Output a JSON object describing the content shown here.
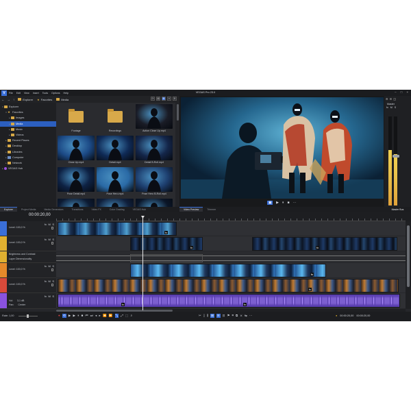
{
  "app": {
    "title": "VEGAS Pro 23.0",
    "logo": "V"
  },
  "menu": [
    "File",
    "Edit",
    "View",
    "Insert",
    "Tools",
    "Options",
    "Help"
  ],
  "explorer_toolbar": {
    "crumbs": [
      "Explorer",
      "Favorites",
      "Media"
    ]
  },
  "tree": [
    {
      "label": "Explorer",
      "indent": 0,
      "icon": "folder",
      "open": true
    },
    {
      "label": "Favorites",
      "indent": 1,
      "icon": "star",
      "open": true
    },
    {
      "label": "Images",
      "indent": 2,
      "icon": "folder"
    },
    {
      "label": "Media",
      "indent": 2,
      "icon": "folder",
      "selected": true
    },
    {
      "label": "Music",
      "indent": 2,
      "icon": "folder"
    },
    {
      "label": "Videos",
      "indent": 2,
      "icon": "folder"
    },
    {
      "label": "Recent Places",
      "indent": 1,
      "icon": "folder"
    },
    {
      "label": "Desktop",
      "indent": 1,
      "icon": "folder"
    },
    {
      "label": "Libraries",
      "indent": 1,
      "icon": "folder"
    },
    {
      "label": "Computer",
      "indent": 1,
      "icon": "pc"
    },
    {
      "label": "Network",
      "indent": 1,
      "icon": "folder"
    },
    {
      "label": "VEGAS Hub",
      "indent": 0,
      "icon": "hub"
    }
  ],
  "media_items": [
    {
      "label": "Footage",
      "kind": "folder"
    },
    {
      "label": "Recordings",
      "kind": "folder"
    },
    {
      "label": "Action Close Up.mp4",
      "kind": "video",
      "tone": "#1a1c26"
    },
    {
      "label": "Close Up.mp4",
      "kind": "video",
      "tone": "#1c4a86"
    },
    {
      "label": "Detail.mp4",
      "kind": "video",
      "tone": "#0f2a56"
    },
    {
      "label": "Detail B-Roll.mp4",
      "kind": "video",
      "tone": "#14264a"
    },
    {
      "label": "Pose Detail.mp4",
      "kind": "video",
      "tone": "#0e2244"
    },
    {
      "label": "Pose Hero.mp4",
      "kind": "video",
      "tone": "#2a6aa6"
    },
    {
      "label": "Pose Hero B-Roll.mp4",
      "kind": "video",
      "tone": "#1d3e6e"
    },
    {
      "label": "",
      "kind": "video",
      "tone": "#0d1b33"
    },
    {
      "label": "",
      "kind": "video",
      "tone": "#10203c"
    },
    {
      "label": "",
      "kind": "video",
      "tone": "#0b1628"
    }
  ],
  "left_tabs": [
    "Explorer",
    "Project Media",
    "Media Generators",
    "Transitions",
    "Video FX",
    "Color Grading",
    "VEGAS Hub"
  ],
  "right_tabs": [
    "Video Preview",
    "Trimmer"
  ],
  "master": {
    "title": "Master",
    "label_bus": "Master Bus",
    "meter_levels": [
      0.62,
      0.58
    ]
  },
  "timeline": {
    "timecode": "00:00:20,00",
    "tracks": [
      {
        "level": "Level: 100,0 %",
        "color": "#3a6fd8"
      },
      {
        "level": "Level: 100,0 %",
        "color": "#e0b030"
      },
      {
        "level": "",
        "color": "#e0b030",
        "envelopes": [
          "Brightness and Contrast",
          "Layer Dimensionality"
        ]
      },
      {
        "level": "Level: 100,0 %",
        "color": "#e58a2a"
      },
      {
        "level": "Level: 100,0 %",
        "color": "#d84a3a"
      },
      {
        "level": "",
        "color": "#8a52e0",
        "vol": "Vol:",
        "vol_val": "3,1 dB",
        "pan": "Pan:",
        "pan_val": "Center"
      }
    ],
    "buttons": {
      "fx": "fx",
      "m": "M",
      "s": "S"
    }
  },
  "bottom": {
    "rate_label": "Rate: 1,00",
    "time1": "00:00:20,00",
    "time2": "00:00:20,00"
  }
}
